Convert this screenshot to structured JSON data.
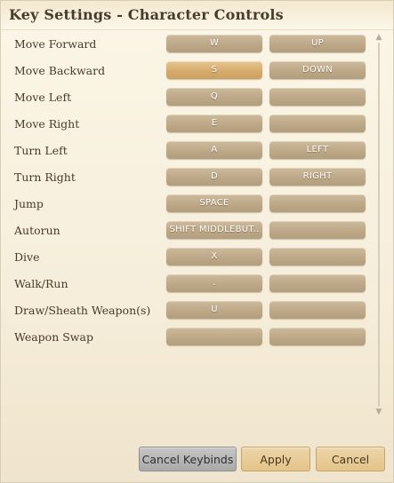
{
  "window": {
    "title": "Key Settings - Character Controls"
  },
  "bindings": [
    {
      "action": "Move Forward",
      "primary": "W",
      "secondary": "UP"
    },
    {
      "action": "Move Backward",
      "primary": "S",
      "secondary": "DOWN"
    },
    {
      "action": "Move Left",
      "primary": "Q",
      "secondary": ""
    },
    {
      "action": "Move Right",
      "primary": "E",
      "secondary": ""
    },
    {
      "action": "Turn Left",
      "primary": "A",
      "secondary": "LEFT"
    },
    {
      "action": "Turn Right",
      "primary": "D",
      "secondary": "RIGHT"
    },
    {
      "action": "Jump",
      "primary": "SPACE",
      "secondary": ""
    },
    {
      "action": "Autorun",
      "primary": "SHIFT MIDDLEBUT..",
      "secondary": ""
    },
    {
      "action": "Dive",
      "primary": "X",
      "secondary": ""
    },
    {
      "action": "Walk/Run",
      "primary": ".",
      "secondary": ""
    },
    {
      "action": "Draw/Sheath Weapon(s)",
      "primary": "U",
      "secondary": ""
    },
    {
      "action": "Weapon Swap",
      "primary": "",
      "secondary": ""
    }
  ],
  "selected_key": "Move Backward / primary",
  "scrollbar": {
    "up_icon": "triangle-up",
    "down_icon": "triangle-down"
  },
  "footer": {
    "cancel_keybinds_label": "Cancel Keybinds",
    "apply_label": "Apply",
    "cancel_label": "Cancel"
  },
  "colors": {
    "background": "#f8f1e0",
    "key_button": "#bfa988",
    "key_button_selected": "#d9b06f",
    "text": "#4a3a28",
    "gold_button": "#e6c98f",
    "gray_button": "#b4b4b4"
  }
}
